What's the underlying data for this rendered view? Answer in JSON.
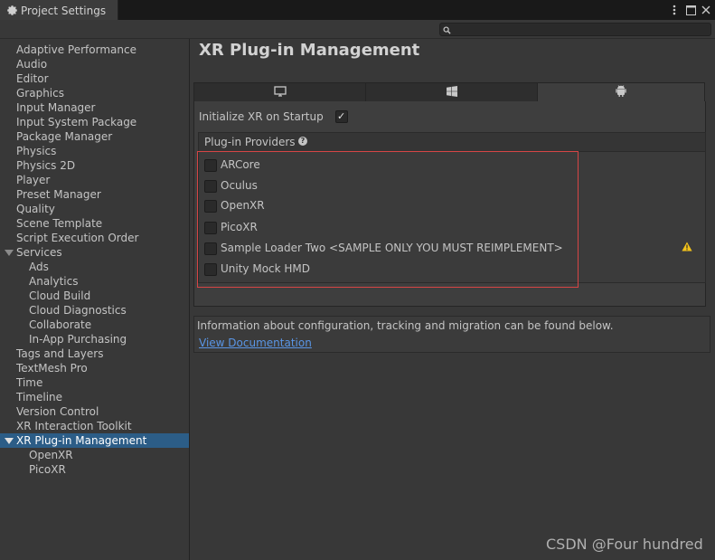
{
  "window": {
    "tab_title": "Project Settings",
    "tab_icon": "gear-icon",
    "buttons": [
      "more-options-icon",
      "maximize-icon",
      "close-icon"
    ]
  },
  "search": {
    "placeholder": "",
    "value": ""
  },
  "sidebar": {
    "items": [
      {
        "label": "Adaptive Performance"
      },
      {
        "label": "Audio"
      },
      {
        "label": "Editor"
      },
      {
        "label": "Graphics"
      },
      {
        "label": "Input Manager"
      },
      {
        "label": "Input System Package"
      },
      {
        "label": "Package Manager"
      },
      {
        "label": "Physics"
      },
      {
        "label": "Physics 2D"
      },
      {
        "label": "Player"
      },
      {
        "label": "Preset Manager"
      },
      {
        "label": "Quality"
      },
      {
        "label": "Scene Template"
      },
      {
        "label": "Script Execution Order"
      },
      {
        "label": "Services",
        "expanded": true
      },
      {
        "label": "Ads"
      },
      {
        "label": "Analytics"
      },
      {
        "label": "Cloud Build"
      },
      {
        "label": "Cloud Diagnostics"
      },
      {
        "label": "Collaborate"
      },
      {
        "label": "In-App Purchasing"
      },
      {
        "label": "Tags and Layers"
      },
      {
        "label": "TextMesh Pro"
      },
      {
        "label": "Time"
      },
      {
        "label": "Timeline"
      },
      {
        "label": "Version Control"
      },
      {
        "label": "XR Interaction Toolkit"
      },
      {
        "label": "XR Plug-in Management",
        "expanded": true,
        "selected": true
      },
      {
        "label": "OpenXR"
      },
      {
        "label": "PicoXR"
      }
    ]
  },
  "main": {
    "title": "XR Plug-in Management",
    "platform_tabs": [
      {
        "icon": "desktop-icon",
        "active": false
      },
      {
        "icon": "windows-icon",
        "active": false
      },
      {
        "icon": "android-icon",
        "active": true
      }
    ],
    "init_label": "Initialize XR on Startup",
    "init_checked": true,
    "providers_title": "Plug-in Providers",
    "providers": [
      {
        "label": "ARCore",
        "checked": false
      },
      {
        "label": "Oculus",
        "checked": false
      },
      {
        "label": "OpenXR",
        "checked": false
      },
      {
        "label": "PicoXR",
        "checked": false
      },
      {
        "label": "Sample Loader Two <SAMPLE ONLY YOU MUST REIMPLEMENT>",
        "checked": false,
        "warning": true
      },
      {
        "label": "Unity Mock HMD",
        "checked": false
      }
    ],
    "info_text": "Information about configuration, tracking and migration can be found below.",
    "doc_link": "View Documentation"
  },
  "colors": {
    "background": "#383838",
    "selection": "#2c5d87",
    "highlight_border": "#d64545",
    "link": "#5a96e6",
    "warning": "#f2c21b"
  },
  "watermark": "CSDN @Four hundred"
}
